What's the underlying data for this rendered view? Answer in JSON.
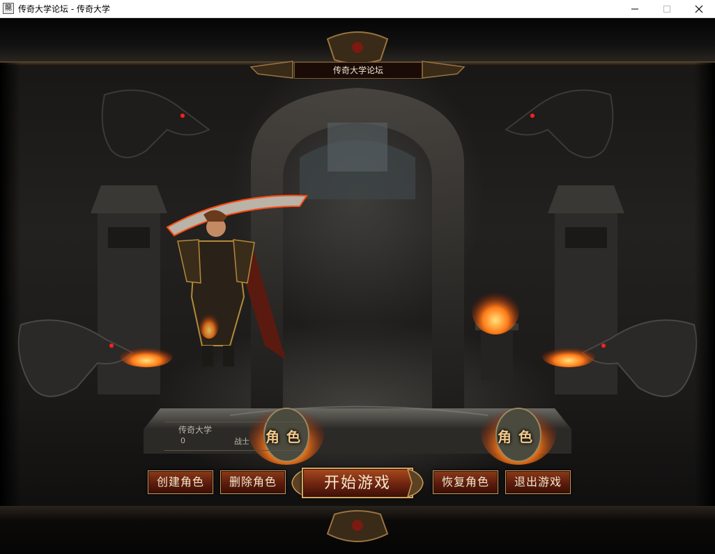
{
  "window": {
    "title": "传奇大学论坛 - 传奇大学",
    "app_icon_glyph": "龍",
    "controls": [
      "minimize-icon",
      "maximize-icon",
      "close-icon"
    ]
  },
  "game": {
    "server_name": "传奇大学论坛",
    "character": {
      "name": "传奇大学",
      "level": "0",
      "class": "战士"
    },
    "slot_badges": [
      {
        "label": "角色"
      },
      {
        "label": "角色"
      }
    ],
    "buttons": {
      "create": "创建角色",
      "delete": "删除角色",
      "start": "开始游戏",
      "restore": "恢复角色",
      "exit": "退出游戏"
    },
    "colors": {
      "button_fill": "#6d2410",
      "button_border": "#c8995a",
      "button_text": "#f4e7cf",
      "flame": "#ff5a14",
      "dragon_eye": "#ff2020"
    }
  }
}
